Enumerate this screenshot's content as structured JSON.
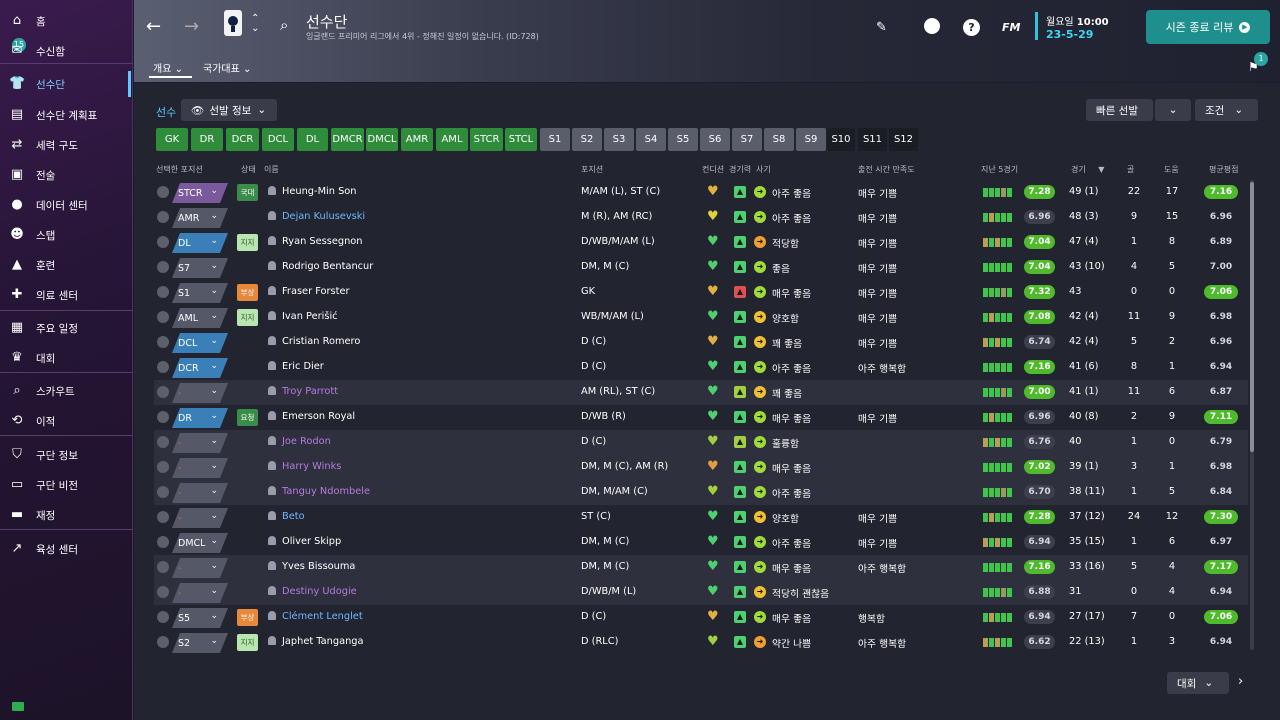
{
  "sidebar": {
    "inbox_badge": "15",
    "items": [
      {
        "label": "홈",
        "icon": "home-icon"
      },
      {
        "label": "수신함",
        "icon": "inbox-icon"
      },
      {
        "label": "선수단",
        "icon": "shirt-icon"
      },
      {
        "label": "선수단 계획표",
        "icon": "clipboard-icon"
      },
      {
        "label": "세력 구도",
        "icon": "dynamics-icon"
      },
      {
        "label": "전술",
        "icon": "tactics-icon"
      },
      {
        "label": "데이터 센터",
        "icon": "data-icon"
      },
      {
        "label": "스탭",
        "icon": "staff-icon"
      },
      {
        "label": "훈련",
        "icon": "training-icon"
      },
      {
        "label": "의료 센터",
        "icon": "medical-icon"
      },
      {
        "label": "주요 일정",
        "icon": "calendar-icon"
      },
      {
        "label": "대회",
        "icon": "trophy-icon"
      },
      {
        "label": "스카우트",
        "icon": "scout-icon"
      },
      {
        "label": "이적",
        "icon": "transfer-icon"
      },
      {
        "label": "구단 정보",
        "icon": "shield-icon"
      },
      {
        "label": "구단 비전",
        "icon": "vision-icon"
      },
      {
        "label": "재정",
        "icon": "finance-icon"
      },
      {
        "label": "육성 센터",
        "icon": "development-icon"
      }
    ]
  },
  "header": {
    "title": "선수단",
    "subtitle": "잉글랜드 프리미어 리그에서 4위 - 정해진 일정이 없습니다. (ID:728)",
    "tabs": [
      "개요",
      "국가대표"
    ],
    "fm_label": "FM",
    "day": "월요일",
    "time": "10:00",
    "date": "23-5-29",
    "season_review": "시즌 종료 리뷰",
    "notif_count": "1"
  },
  "filters": {
    "label": "선수",
    "view": "선발 정보",
    "quick_select": "빠른 선발",
    "condition": "조건",
    "positions": [
      "GK",
      "DR",
      "DCR",
      "DCL",
      "DL",
      "DMCR",
      "DMCL",
      "AMR",
      "AML",
      "STCR",
      "STCL",
      "S1",
      "S2",
      "S3",
      "S4",
      "S5",
      "S6",
      "S7",
      "S8",
      "S9",
      "S10",
      "S11",
      "S12"
    ]
  },
  "columns": {
    "selected_pos": "선택한 포지션",
    "status": "상태",
    "name": "이름",
    "position": "포지션",
    "condition": "컨디션",
    "sharpness": "경기력",
    "morale": "사기",
    "playing_time": "출전 시간 만족도",
    "last5": "지난 5경기",
    "games": "경기",
    "goals": "골",
    "assists": "도움",
    "avg_rating": "평균평점"
  },
  "players": [
    {
      "sel": "STCR",
      "status": "국대",
      "name": "Heung-Min Son",
      "pos": "M/AM (L), ST (C)",
      "morale": "아주 좋음",
      "pt": "매우 기쁨",
      "last": "7.28",
      "apps": "49 (1)",
      "goals": "22",
      "assists": "17",
      "avg": "7.16"
    },
    {
      "sel": "AMR",
      "status": "",
      "name": "Dejan Kulusevski",
      "pos": "M (R), AM (RC)",
      "morale": "아주 좋음",
      "pt": "매우 기쁨",
      "last": "6.96",
      "apps": "48 (3)",
      "goals": "9",
      "assists": "15",
      "avg": "6.96"
    },
    {
      "sel": "DL",
      "status": "지지",
      "name": "Ryan Sessegnon",
      "pos": "D/WB/M/AM (L)",
      "morale": "적당함",
      "pt": "매우 기쁨",
      "last": "7.04",
      "apps": "47 (4)",
      "goals": "1",
      "assists": "8",
      "avg": "6.89"
    },
    {
      "sel": "S7",
      "status": "",
      "name": "Rodrigo Bentancur",
      "pos": "DM, M (C)",
      "morale": "좋음",
      "pt": "매우 기쁨",
      "last": "7.04",
      "apps": "43 (10)",
      "goals": "4",
      "assists": "5",
      "avg": "7.00"
    },
    {
      "sel": "S1",
      "status": "부상",
      "name": "Fraser Forster",
      "pos": "GK",
      "morale": "매우 좋음",
      "pt": "매우 기쁨",
      "last": "7.32",
      "apps": "43",
      "goals": "0",
      "assists": "0",
      "avg": "7.06"
    },
    {
      "sel": "AML",
      "status": "지지",
      "name": "Ivan Perišić",
      "pos": "WB/M/AM (L)",
      "morale": "양호함",
      "pt": "매우 기쁨",
      "last": "7.08",
      "apps": "42 (4)",
      "goals": "11",
      "assists": "9",
      "avg": "6.98"
    },
    {
      "sel": "DCL",
      "status": "",
      "name": "Cristian Romero",
      "pos": "D (C)",
      "morale": "꽤 좋음",
      "pt": "매우 기쁨",
      "last": "6.74",
      "apps": "42 (4)",
      "goals": "5",
      "assists": "2",
      "avg": "6.96"
    },
    {
      "sel": "DCR",
      "status": "",
      "name": "Eric Dier",
      "pos": "D (C)",
      "morale": "아주 좋음",
      "pt": "아주 행복함",
      "last": "7.16",
      "apps": "41 (6)",
      "goals": "8",
      "assists": "1",
      "avg": "6.94"
    },
    {
      "sel": "-",
      "status": "",
      "name": "Troy Parrott",
      "pos": "AM (RL), ST (C)",
      "morale": "꽤 좋음",
      "pt": "",
      "last": "7.00",
      "apps": "41 (1)",
      "goals": "11",
      "assists": "6",
      "avg": "6.87"
    },
    {
      "sel": "DR",
      "status": "요청",
      "name": "Emerson Royal",
      "pos": "D/WB (R)",
      "morale": "매우 좋음",
      "pt": "매우 기쁨",
      "last": "6.96",
      "apps": "40 (8)",
      "goals": "2",
      "assists": "9",
      "avg": "7.11"
    },
    {
      "sel": "-",
      "status": "",
      "name": "Joe Rodon",
      "pos": "D (C)",
      "morale": "훌륭함",
      "pt": "",
      "last": "6.76",
      "apps": "40",
      "goals": "1",
      "assists": "0",
      "avg": "6.79"
    },
    {
      "sel": "-",
      "status": "",
      "name": "Harry Winks",
      "pos": "DM, M (C), AM (R)",
      "morale": "매우 좋음",
      "pt": "",
      "last": "7.02",
      "apps": "39 (1)",
      "goals": "3",
      "assists": "1",
      "avg": "6.98"
    },
    {
      "sel": "-",
      "status": "",
      "name": "Tanguy Ndombele",
      "pos": "DM, M/AM (C)",
      "morale": "아주 좋음",
      "pt": "",
      "last": "6.70",
      "apps": "38 (11)",
      "goals": "1",
      "assists": "5",
      "avg": "6.84"
    },
    {
      "sel": "-",
      "status": "",
      "name": "Beto",
      "pos": "ST (C)",
      "morale": "양호함",
      "pt": "매우 기쁨",
      "last": "7.28",
      "apps": "37 (12)",
      "goals": "24",
      "assists": "12",
      "avg": "7.30"
    },
    {
      "sel": "DMCL",
      "status": "",
      "name": "Oliver Skipp",
      "pos": "DM, M (C)",
      "morale": "아주 좋음",
      "pt": "매우 기쁨",
      "last": "6.94",
      "apps": "35 (15)",
      "goals": "1",
      "assists": "6",
      "avg": "6.97"
    },
    {
      "sel": "-",
      "status": "",
      "name": "Yves Bissouma",
      "pos": "DM, M (C)",
      "morale": "매우 좋음",
      "pt": "아주 행복함",
      "last": "7.16",
      "apps": "33 (16)",
      "goals": "5",
      "assists": "4",
      "avg": "7.17"
    },
    {
      "sel": "-",
      "status": "",
      "name": "Destiny Udogie",
      "pos": "D/WB/M (L)",
      "morale": "적당히 괜찮음",
      "pt": "",
      "last": "6.88",
      "apps": "31",
      "goals": "0",
      "assists": "4",
      "avg": "6.94"
    },
    {
      "sel": "S5",
      "status": "부상",
      "name": "Clément Lenglet",
      "pos": "D (C)",
      "morale": "매우 좋음",
      "pt": "행복함",
      "last": "6.94",
      "apps": "27 (17)",
      "goals": "7",
      "assists": "0",
      "avg": "7.06"
    },
    {
      "sel": "S2",
      "status": "지지",
      "name": "Japhet Tanganga",
      "pos": "D (RLC)",
      "morale": "약간 나쁨",
      "pt": "아주 행복함",
      "last": "6.62",
      "apps": "22 (13)",
      "goals": "1",
      "assists": "3",
      "avg": "6.94"
    }
  ],
  "footer": {
    "competition": "대회"
  }
}
